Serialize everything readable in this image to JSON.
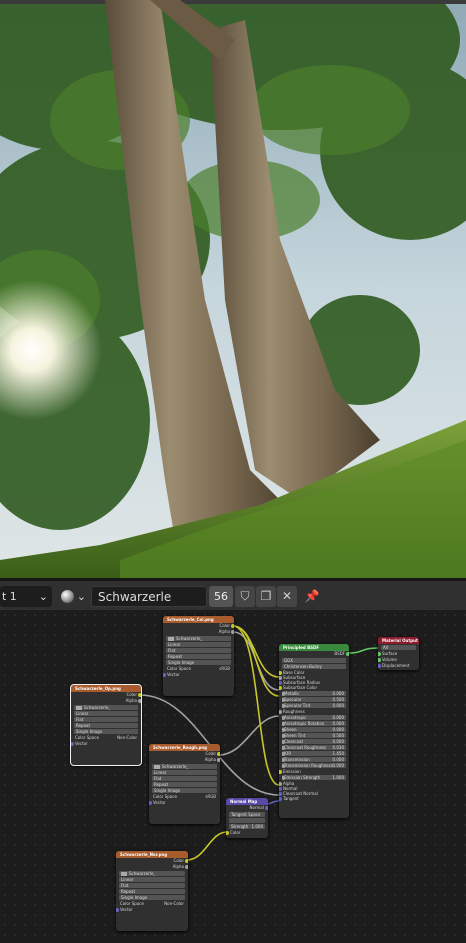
{
  "header": {
    "slot_label": "t 1",
    "material_name": "Schwarzerle",
    "user_count": "56"
  },
  "nodes": {
    "tex_top": {
      "title": "Schwarzerle_Col.png",
      "out_color": "Color",
      "out_alpha": "Alpha",
      "image": "Schwarzerle_",
      "interp": "Linear",
      "proj": "Flat",
      "ext": "Repeat",
      "src": "Single Image",
      "cs_label": "Color Space",
      "cs_value": "sRGB",
      "vector": "Vector"
    },
    "tex_left": {
      "title": "Schwarzerle_Op.png",
      "out_color": "Color",
      "out_alpha": "Alpha",
      "image": "Schwarzerle_",
      "interp": "Linear",
      "proj": "Flat",
      "ext": "Repeat",
      "src": "Single Image",
      "cs_label": "Color Space",
      "cs_value": "Non-Color",
      "vector": "Vector"
    },
    "tex_mid": {
      "title": "Schwarzerle_Rough.png",
      "out_color": "Color",
      "out_alpha": "Alpha",
      "image": "Schwarzerle_",
      "interp": "Linear",
      "proj": "Flat",
      "ext": "Repeat",
      "src": "Single Image",
      "cs_label": "Color Space",
      "cs_value": "sRGB",
      "vector": "Vector"
    },
    "tex_bottom": {
      "title": "Schwarzerle_Nor.png",
      "out_color": "Color",
      "out_alpha": "Alpha",
      "image": "Schwarzerle_",
      "interp": "Linear",
      "proj": "Flat",
      "ext": "Repeat",
      "src": "Single Image",
      "cs_label": "Color Space",
      "cs_value": "Non-Color",
      "vector": "Vector"
    },
    "bsdf": {
      "title": "Principled BSDF",
      "out": "BSDF",
      "dist": "GGX",
      "ss_method": "Christensen-Burley",
      "rows": [
        {
          "label": "Base Color",
          "value": ""
        },
        {
          "label": "Subsurface",
          "value": ""
        },
        {
          "label": "Subsurface Radius",
          "value": ""
        },
        {
          "label": "Subsurface Color",
          "value": ""
        },
        {
          "label": "Metallic",
          "value": "0.000"
        },
        {
          "label": "Specular",
          "value": "0.500"
        },
        {
          "label": "Specular Tint",
          "value": "0.000"
        },
        {
          "label": "Roughness",
          "value": ""
        },
        {
          "label": "Anisotropic",
          "value": "0.000"
        },
        {
          "label": "Anisotropic Rotation",
          "value": "0.000"
        },
        {
          "label": "Sheen",
          "value": "0.000"
        },
        {
          "label": "Sheen Tint",
          "value": "0.500"
        },
        {
          "label": "Clearcoat",
          "value": "0.000"
        },
        {
          "label": "Clearcoat Roughness",
          "value": "0.030"
        },
        {
          "label": "IOR",
          "value": "1.450"
        },
        {
          "label": "Transmission",
          "value": "0.000"
        },
        {
          "label": "Transmission Roughness",
          "value": "0.000"
        },
        {
          "label": "Emission",
          "value": ""
        },
        {
          "label": "Emission Strength",
          "value": "1.000"
        },
        {
          "label": "Alpha",
          "value": ""
        },
        {
          "label": "Normal",
          "value": ""
        },
        {
          "label": "Clearcoat Normal",
          "value": ""
        },
        {
          "label": "Tangent",
          "value": ""
        }
      ]
    },
    "output": {
      "title": "Material Output",
      "target": "All",
      "surface": "Surface",
      "volume": "Volume",
      "disp": "Displacement"
    },
    "normal": {
      "title": "Normal Map",
      "out": "Normal",
      "space": "Tangent Space",
      "strength_label": "Strength",
      "strength_value": "1.000",
      "color": "Color"
    }
  },
  "colors": {
    "sky": "#b9cfd9",
    "grass": "#4f7a22",
    "foliage": "#2f5a1f",
    "bark": "#7a6a52",
    "texture_header": "#a85b2d",
    "bsdf_header": "#3a8a3d",
    "output_header": "#8c1c2d",
    "vector_header": "#5a4aa8"
  }
}
